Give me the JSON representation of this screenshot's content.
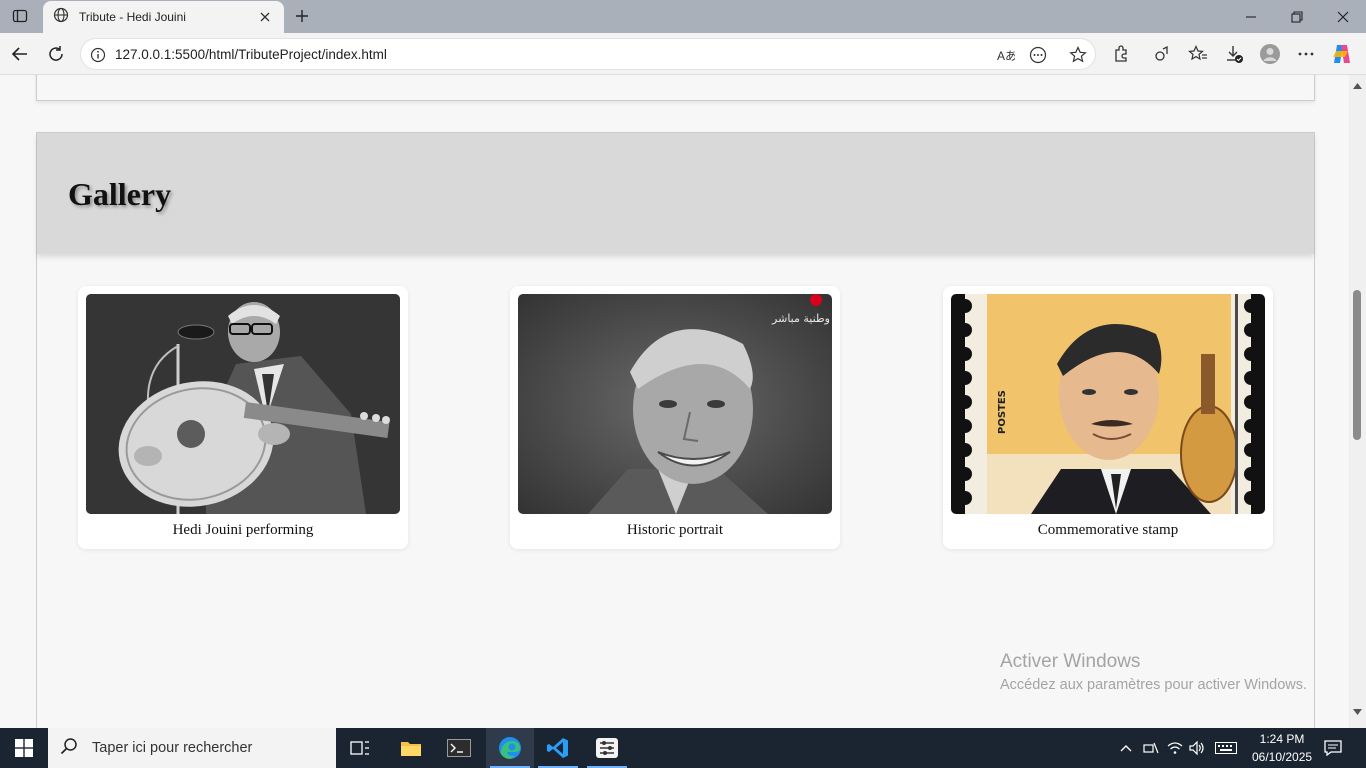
{
  "browser": {
    "tab_title": "Tribute - Hedi Jouini",
    "url": "127.0.0.1:5500/html/TributeProject/index.html"
  },
  "page": {
    "gallery_title": "Gallery",
    "cards": [
      {
        "caption": "Hedi Jouini performing",
        "image": "oud-player-photo"
      },
      {
        "caption": "Historic portrait",
        "image": "smiling-portrait-photo"
      },
      {
        "caption": "Commemorative stamp",
        "image": "postage-stamp-illustration"
      }
    ],
    "stamp_text": "POSTES",
    "tv_logo_text": "وطنية مباشر"
  },
  "watermark": {
    "title": "Activer Windows",
    "subtitle": "Accédez aux paramètres pour activer Windows."
  },
  "taskbar": {
    "search_placeholder": "Taper ici pour rechercher",
    "time": "1:24 PM",
    "date": "06/10/2025"
  },
  "colors": {
    "header_bg": "#d9d9d9",
    "page_bg": "#f7f7f7",
    "taskbar_bg": "#1b2431",
    "tabbar_bg": "#aab0ba"
  }
}
